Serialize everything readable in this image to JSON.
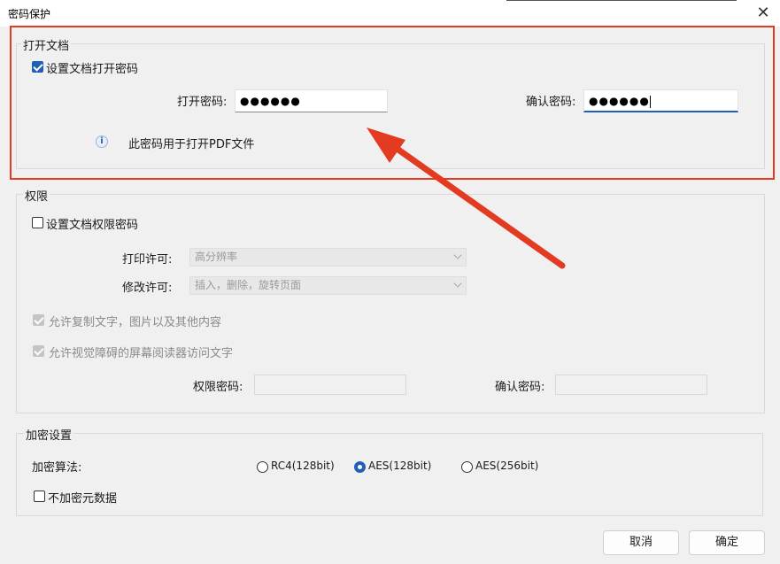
{
  "window": {
    "title": "密码保护",
    "close_symbol": "✕"
  },
  "open_doc": {
    "group_title": "打开文档",
    "set_password_label": "设置文档打开密码",
    "set_password_checked": true,
    "open_password_label": "打开密码:",
    "open_password_value": "●●●●●●",
    "confirm_password_label": "确认密码:",
    "confirm_password_value": "●●●●●●",
    "info_text": "此密码用于打开PDF文件",
    "info_icon": "info-icon"
  },
  "permissions": {
    "group_title": "权限",
    "set_password_label": "设置文档权限密码",
    "set_password_checked": false,
    "print_label": "打印许可:",
    "print_value": "高分辨率",
    "modify_label": "修改许可:",
    "modify_value": "插入，删除，旋转页面",
    "allow_copy_label": "允许复制文字，图片以及其他内容",
    "allow_reader_label": "允许视觉障碍的屏幕阅读器访问文字",
    "perm_password_label": "权限密码:",
    "confirm_password_label": "确认密码:"
  },
  "encryption": {
    "group_title": "加密设置",
    "algorithm_label": "加密算法:",
    "options": [
      "RC4(128bit)",
      "AES(128bit)",
      "AES(256bit)"
    ],
    "selected": "AES(128bit)",
    "no_metadata_label": "不加密元数据",
    "no_metadata_checked": false
  },
  "buttons": {
    "cancel": "取消",
    "ok": "确定"
  },
  "colors": {
    "highlight": "#e33b22",
    "accent": "#1f5fb8"
  }
}
